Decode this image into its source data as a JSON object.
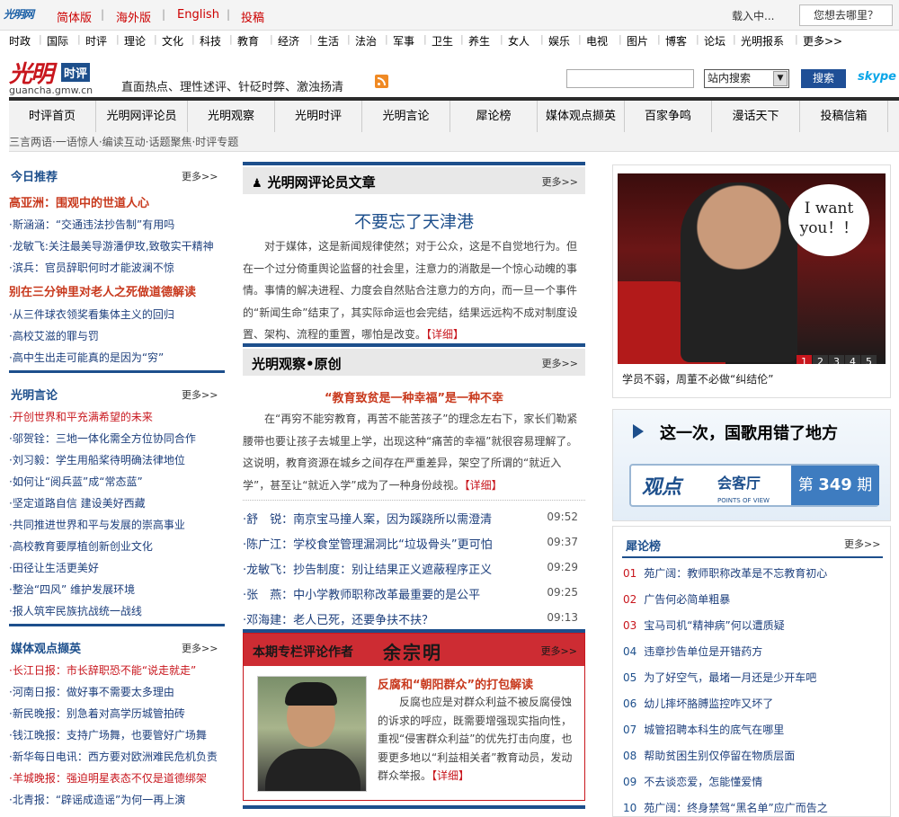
{
  "topbar": {
    "logo_text": "光明网",
    "logo_sub": "GMW.CN",
    "links": [
      "简体版",
      "海外版",
      "English",
      "投稿"
    ],
    "loading": "载入中...",
    "where_label": "您想去哪里？"
  },
  "channels": [
    "时政",
    "国际",
    "时评",
    "理论",
    "文化",
    "科技",
    "教育",
    "经济",
    "生活",
    "法治",
    "军事",
    "卫生",
    "养生",
    "女人",
    "娱乐",
    "电视",
    "图片",
    "博客",
    "论坛",
    "光明报系",
    "更多>>"
  ],
  "header": {
    "logo_big": "光明",
    "logo_tag": "时评",
    "logo_url": "guancha.gmw.cn",
    "slogan": "直面热点、理性述评、针砭时弊、激浊扬清",
    "search_select": "站内搜索",
    "search_button": "搜索",
    "skype": "skype"
  },
  "nav": [
    "时评首页",
    "光明网评论员",
    "光明观察",
    "光明时评",
    "光明言论",
    "犀论榜",
    "媒体观点撷英",
    "百家争鸣",
    "漫话天下",
    "投稿信箱"
  ],
  "subbar": "三言两语·一语惊人·编读互动·话题聚焦·时评专题",
  "left": {
    "today": {
      "title": "今日推荐",
      "more": "更多>>",
      "items": [
        {
          "text": "高亚洲：围观中的世道人心",
          "style": "hl"
        },
        {
          "text": "·斯涵涵：“交通违法抄告制”有用吗",
          "style": ""
        },
        {
          "text": "·龙敏飞:关注最美导游潘伊玫,致敬实干精神",
          "style": ""
        },
        {
          "text": "·滨兵：官员辞职何时才能波澜不惊",
          "style": ""
        },
        {
          "text": "别在三分钟里对老人之死做道德解读",
          "style": "hl"
        },
        {
          "text": "·从三件球衣领奖看集体主义的回归",
          "style": ""
        },
        {
          "text": "·高校艾滋的罪与罚",
          "style": ""
        },
        {
          "text": "·高中生出走可能真的是因为“穷”",
          "style": ""
        }
      ]
    },
    "yanlun": {
      "title": "光明言论",
      "more": "更多>>",
      "items": [
        {
          "text": "·开创世界和平充满希望的未来",
          "style": "red"
        },
        {
          "text": "·邬贺铨：三地一体化需全方位协同合作",
          "style": ""
        },
        {
          "text": "·刘习毅：学生用船桨待明确法律地位",
          "style": ""
        },
        {
          "text": "·如何让“阅兵蓝”成“常态蓝”",
          "style": ""
        },
        {
          "text": "·坚定道路自信 建设美好西藏",
          "style": ""
        },
        {
          "text": "·共同推进世界和平与发展的崇高事业",
          "style": ""
        },
        {
          "text": "·高校教育要厚植创新创业文化",
          "style": ""
        },
        {
          "text": "·田径让生活更美好",
          "style": ""
        },
        {
          "text": "·整治“四风” 维护发展环境",
          "style": ""
        },
        {
          "text": "·报人筑牢民族抗战统一战线",
          "style": ""
        }
      ]
    },
    "media": {
      "title": "媒体观点撷英",
      "more": "更多>>",
      "items": [
        {
          "text": "·长江日报：市长辞职恐不能“说走就走”",
          "style": "red"
        },
        {
          "text": "·河南日报：做好事不需要太多理由",
          "style": ""
        },
        {
          "text": "·新民晚报：别急着对高学历城管拍砖",
          "style": ""
        },
        {
          "text": "·钱江晚报：支持广场舞，也要管好广场舞",
          "style": ""
        },
        {
          "text": "·新华每日电讯：西方要对欧洲难民危机负责",
          "style": ""
        },
        {
          "text": "·羊城晚报：强迫明星表态不仅是道德绑架",
          "style": "red"
        },
        {
          "text": "·北青报：“辟谣成造谣”为何一再上演",
          "style": ""
        }
      ]
    }
  },
  "middle": {
    "commentator": {
      "title": "光明网评论员文章",
      "more": "更多>>",
      "headline": "不要忘了天津港",
      "body": "对于媒体，这是新闻规律使然；对于公众，这是不自觉地行为。但在一个过分倚重舆论监督的社会里，注意力的消散是一个惊心动魄的事情。事情的解决进程、力度会自然贴合注意力的方向，而一旦一个事件的“新闻生命”结束了，其实际命运也会完结，结果远远构不成对制度设置、架构、流程的重置，哪怕是改变。",
      "detail": "【详细】"
    },
    "observe": {
      "title": "光明观察•原创",
      "more": "更多>>",
      "headline": "“教育致贫是一种幸福”是一种不幸",
      "body": "在“再穷不能穷教育，再苦不能苦孩子”的理念左右下，家长们勒紧腰带也要让孩子去城里上学，出现这种“痛苦的幸福”就很容易理解了。这说明，教育资源在城乡之间存在严重差异，架空了所谓的“就近入学”，甚至让“就近入学”成为了一种身份歧视。",
      "detail": "【详细】"
    },
    "news": [
      {
        "text": "·舒　锐：南京宝马撞人案，因为蹊跷所以需澄清",
        "time": "09:52"
      },
      {
        "text": "·陈广江：学校食堂管理漏洞比“垃圾骨头”更可怕",
        "time": "09:37"
      },
      {
        "text": "·龙敏飞：抄告制度：别让结果正义遮蔽程序正义",
        "time": "09:29"
      },
      {
        "text": "·张　燕：中小学教师职称改革最重要的是公平",
        "time": "09:25"
      },
      {
        "text": "·邓海建：老人已死，还要争扶不扶？",
        "time": "09:13"
      }
    ],
    "author": {
      "label": "本期专栏评论作者",
      "name": "余宗明",
      "more": "更多>>",
      "title": "反腐和“朝阳群众”的打包解读",
      "body": "反腐也应是对群众利益不被反腐侵蚀的诉求的呼应，既需要增强现实指向性，重视“侵害群众利益”的优先打击向度，也要更多地以“利益相关者”教育动员，发动群众举报。",
      "detail": "【详细】"
    }
  },
  "right": {
    "promo": {
      "bubble": "I want you！！",
      "pages": [
        "1",
        "2",
        "3",
        "4",
        "5"
      ],
      "caption": "学员不弱，周董不必做“纠结伦”"
    },
    "anthem": {
      "title": "这一次，国歌用错了地方",
      "banner_a": "观点",
      "banner_b": "会客厅",
      "banner_c": "POINTS OF VIEW",
      "issue_prefix": "第",
      "issue": "349",
      "issue_suffix": "期"
    },
    "rank": {
      "title": "犀论榜",
      "more": "更多>>",
      "items": [
        {
          "n": "01",
          "text": "苑广阔：教师职称改革是不忘教育初心"
        },
        {
          "n": "02",
          "text": "广告何必简单粗暴"
        },
        {
          "n": "03",
          "text": "宝马司机“精神病”何以遭质疑"
        },
        {
          "n": "04",
          "text": "违章抄告单位是开错药方"
        },
        {
          "n": "05",
          "text": "为了好空气，最堵一月还是少开车吧"
        },
        {
          "n": "06",
          "text": "幼儿摔坏胳膊监控咋又坏了"
        },
        {
          "n": "07",
          "text": "城管招聘本科生的底气在哪里"
        },
        {
          "n": "08",
          "text": "帮助贫困生别仅停留在物质层面"
        },
        {
          "n": "09",
          "text": "不去谈恋爱，怎能懂爱情"
        },
        {
          "n": "10",
          "text": "苑广阔：终身禁驾“黑名单”应广而告之"
        }
      ]
    }
  }
}
